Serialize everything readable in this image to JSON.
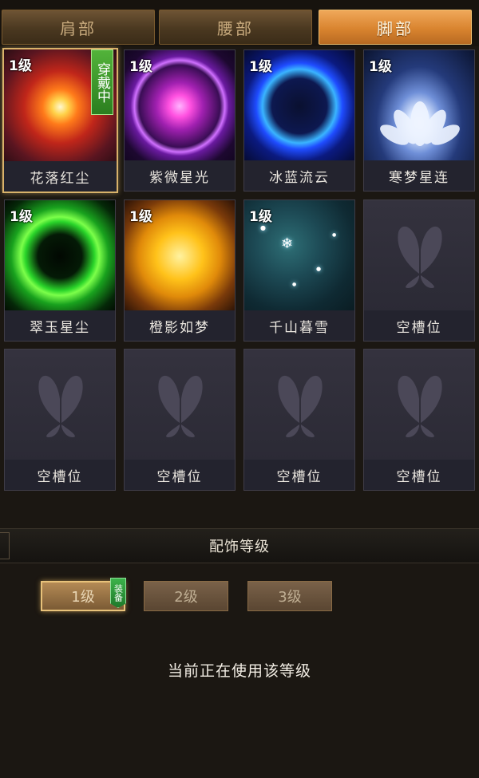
{
  "tabs": [
    {
      "label": "肩部",
      "active": false
    },
    {
      "label": "腰部",
      "active": false
    },
    {
      "label": "脚部",
      "active": true
    }
  ],
  "slots": [
    {
      "name": "花落红尘",
      "level": "1级",
      "art": "red",
      "equipped": true,
      "badge": "穿戴中"
    },
    {
      "name": "紫微星光",
      "level": "1级",
      "art": "purple"
    },
    {
      "name": "冰蓝流云",
      "level": "1级",
      "art": "blue"
    },
    {
      "name": "寒梦星连",
      "level": "1级",
      "art": "lotus"
    },
    {
      "name": "翠玉星尘",
      "level": "1级",
      "art": "green"
    },
    {
      "name": "橙影如梦",
      "level": "1级",
      "art": "orange"
    },
    {
      "name": "千山暮雪",
      "level": "1级",
      "art": "teal"
    },
    {
      "name": "空槽位",
      "art": "empty"
    },
    {
      "name": "空槽位",
      "art": "empty"
    },
    {
      "name": "空槽位",
      "art": "empty"
    },
    {
      "name": "空槽位",
      "art": "empty"
    },
    {
      "name": "空槽位",
      "art": "empty"
    }
  ],
  "section": {
    "title": "配饰等级"
  },
  "level_buttons": [
    {
      "label": "1级",
      "active": true,
      "tag": "装备"
    },
    {
      "label": "2级",
      "active": false
    },
    {
      "label": "3级",
      "active": false
    }
  ],
  "status_text": "当前正在使用该等级"
}
